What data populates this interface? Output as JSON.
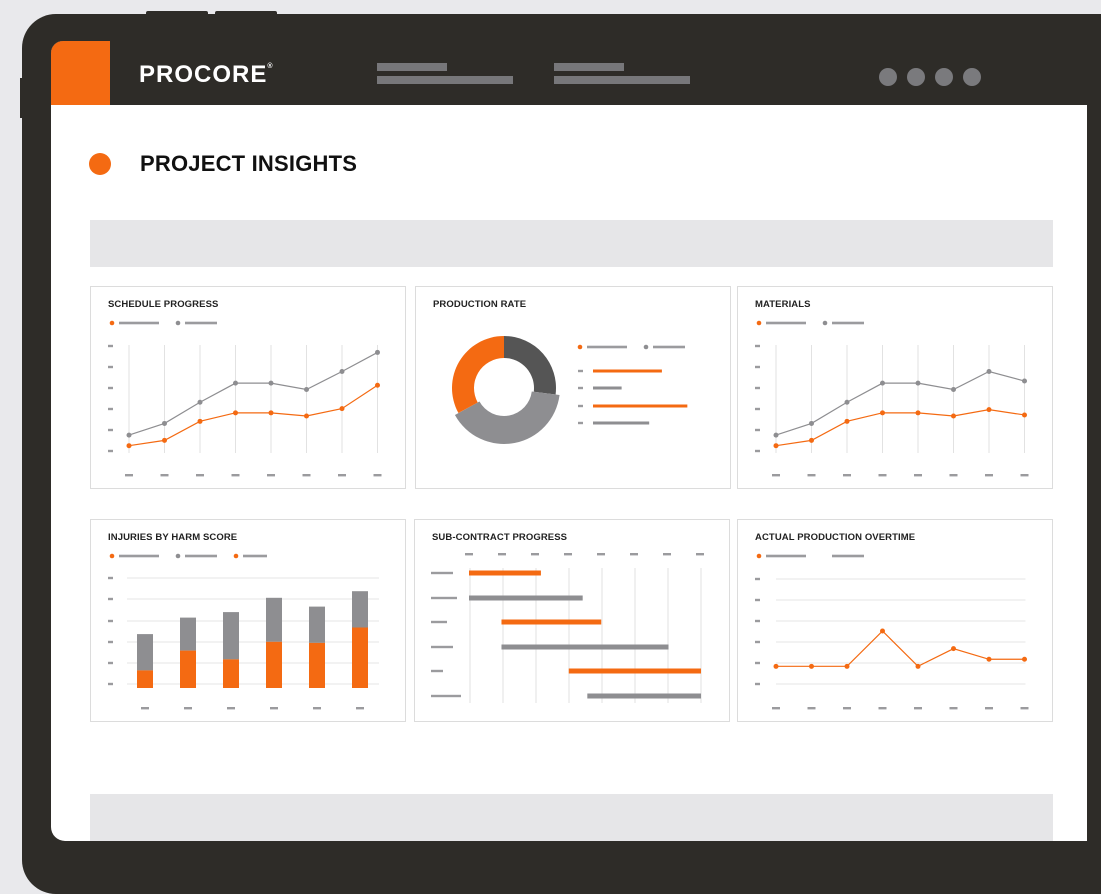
{
  "app": {
    "brand": "PROCORE",
    "brand_mark": "®"
  },
  "page": {
    "title": "PROJECT INSIGHTS"
  },
  "colors": {
    "accent": "#f46a12",
    "dark": "#2e2c28",
    "gray": "#8e8e91",
    "darkgray": "#555555",
    "placeholder": "#9b9b9e"
  },
  "cards": [
    {
      "title": "SCHEDULE PROGRESS",
      "chart_data": {
        "type": "line",
        "categories": 8,
        "series": [
          {
            "color": "orange",
            "values": [
              0.5,
              1.0,
              2.8,
              3.6,
              3.6,
              3.3,
              4.0,
              6.2
            ]
          },
          {
            "color": "gray",
            "values": [
              1.5,
              2.6,
              4.6,
              6.4,
              6.4,
              5.8,
              7.5,
              9.3
            ]
          }
        ],
        "ylim": [
          0,
          10
        ]
      }
    },
    {
      "title": "PRODUCTION RATE",
      "chart_data": {
        "type": "pie",
        "donut": true,
        "slices": [
          {
            "color": "orange",
            "value": 0.33
          },
          {
            "color": "darkgray",
            "value": 0.27
          },
          {
            "color": "gray",
            "value": 0.4
          }
        ],
        "bars": [
          0.65,
          0.27,
          0.89,
          0.53
        ]
      }
    },
    {
      "title": "MATERIALS",
      "chart_data": {
        "type": "line",
        "categories": 8,
        "series": [
          {
            "color": "orange",
            "values": [
              0.5,
              1.0,
              2.8,
              3.6,
              3.6,
              3.3,
              3.9,
              3.4
            ]
          },
          {
            "color": "gray",
            "values": [
              1.5,
              2.6,
              4.6,
              6.4,
              6.4,
              5.8,
              7.5,
              6.6
            ]
          }
        ],
        "ylim": [
          0,
          10
        ]
      }
    },
    {
      "title": "INJURIES BY HARM SCORE",
      "chart_data": {
        "type": "bar",
        "stacked": true,
        "series": [
          {
            "color": "orange",
            "values": [
              16,
              34,
              26,
              42,
              41,
              55
            ]
          },
          {
            "color": "gray",
            "values": [
              33,
              30,
              43,
              40,
              33,
              33
            ]
          }
        ],
        "ylim": [
          0,
          100
        ]
      }
    },
    {
      "title": "SUB-CONTRACT PROGRESS",
      "chart_data": {
        "type": "bar",
        "orientation": "gantt",
        "ranges": [
          {
            "color": "orange",
            "start": 0.0,
            "end": 0.31
          },
          {
            "color": "gray",
            "start": 0.0,
            "end": 0.49
          },
          {
            "color": "orange",
            "start": 0.14,
            "end": 0.57
          },
          {
            "color": "gray",
            "start": 0.14,
            "end": 0.86
          },
          {
            "color": "orange",
            "start": 0.43,
            "end": 1.0
          },
          {
            "color": "gray",
            "start": 0.51,
            "end": 1.0
          }
        ]
      }
    },
    {
      "title": "ACTUAL PRODUCTION OVERTIME",
      "chart_data": {
        "type": "line",
        "categories": 8,
        "series": [
          {
            "color": "orange",
            "values": [
              1.0,
              1.0,
              1.0,
              3.0,
              1.0,
              2.0,
              1.4,
              1.4
            ]
          }
        ],
        "ylim": [
          0,
          6
        ]
      }
    }
  ]
}
